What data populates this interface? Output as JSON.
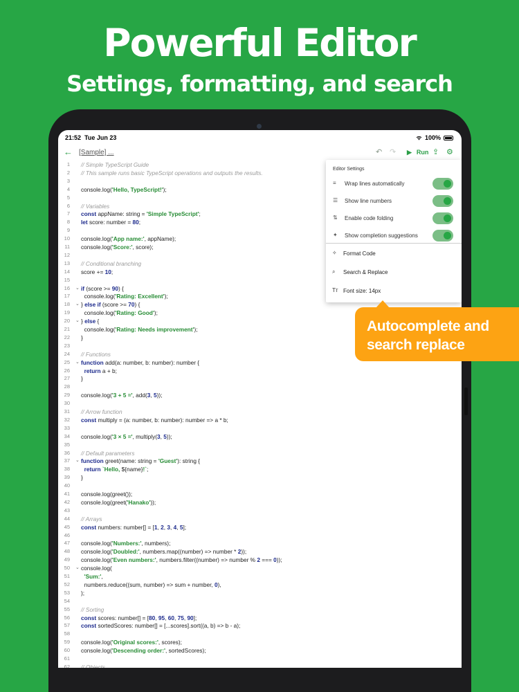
{
  "hero": {
    "title": "Powerful Editor",
    "subtitle": "Settings, formatting, and search"
  },
  "status": {
    "time": "21:52",
    "date": "Tue Jun 23",
    "battery": "100%"
  },
  "toolbar": {
    "file_title": "[Sample] ...",
    "run_label": "Run"
  },
  "menu": {
    "header": "Editor Settings",
    "toggles": [
      {
        "label": "Wrap lines automatically",
        "icon": "wrap-lines-icon",
        "on": true
      },
      {
        "label": "Show line numbers",
        "icon": "list-numbers-icon",
        "on": true
      },
      {
        "label": "Enable code folding",
        "icon": "fold-icon",
        "on": true
      },
      {
        "label": "Show completion suggestions",
        "icon": "magic-wand-icon",
        "on": true
      }
    ],
    "actions": [
      {
        "label": "Format Code",
        "icon": "sparkle-icon"
      },
      {
        "label": "Search & Replace",
        "icon": "search-replace-icon"
      },
      {
        "label": "Font size: 14px",
        "icon": "font-size-icon"
      }
    ]
  },
  "callout": {
    "line1": "Autocomplete and",
    "line2": "search replace"
  },
  "colors": {
    "background": "#27a645",
    "accent": "#2a9d46",
    "callout": "#fda313"
  },
  "code_lines": [
    {
      "n": "1",
      "fold": "",
      "html": "<span class=\"c\">// Simple TypeScript Guide</span>"
    },
    {
      "n": "2",
      "fold": "",
      "html": "<span class=\"c\">// This sample runs basic TypeScript operations and outputs the results.</span>"
    },
    {
      "n": "3",
      "fold": "",
      "html": ""
    },
    {
      "n": "4",
      "fold": "",
      "html": "console.log(<span class=\"s\">'Hello, TypeScript!'</span>);"
    },
    {
      "n": "5",
      "fold": "",
      "html": ""
    },
    {
      "n": "6",
      "fold": "",
      "html": "<span class=\"c\">// Variables</span>"
    },
    {
      "n": "7",
      "fold": "",
      "html": "<span class=\"k\">const</span> appName: string = <span class=\"s\">'Simple TypeScript'</span>;"
    },
    {
      "n": "8",
      "fold": "",
      "html": "<span class=\"k\">let</span> score: number = <span class=\"n\">80</span>;"
    },
    {
      "n": "9",
      "fold": "",
      "html": ""
    },
    {
      "n": "10",
      "fold": "",
      "html": "console.log(<span class=\"s\">'App name:'</span>, appName);"
    },
    {
      "n": "11",
      "fold": "",
      "html": "console.log(<span class=\"s\">'Score:'</span>, score);"
    },
    {
      "n": "12",
      "fold": "",
      "html": ""
    },
    {
      "n": "13",
      "fold": "",
      "html": "<span class=\"c\">// Conditional branching</span>"
    },
    {
      "n": "14",
      "fold": "",
      "html": "score += <span class=\"n\">10</span>;"
    },
    {
      "n": "15",
      "fold": "",
      "html": ""
    },
    {
      "n": "16",
      "fold": "⌄",
      "html": "<span class=\"k\">if</span> (score &gt;= <span class=\"n\">90</span>) {"
    },
    {
      "n": "17",
      "fold": "",
      "html": "  console.log(<span class=\"s\">'Rating: Excellent'</span>);"
    },
    {
      "n": "18",
      "fold": "⌄",
      "html": "} <span class=\"k\">else if</span> (score &gt;= <span class=\"n\">70</span>) {"
    },
    {
      "n": "19",
      "fold": "",
      "html": "  console.log(<span class=\"s\">'Rating: Good'</span>);"
    },
    {
      "n": "20",
      "fold": "⌄",
      "html": "} <span class=\"k\">else</span> {"
    },
    {
      "n": "21",
      "fold": "",
      "html": "  console.log(<span class=\"s\">'Rating: Needs improvement'</span>);"
    },
    {
      "n": "22",
      "fold": "",
      "html": "}"
    },
    {
      "n": "23",
      "fold": "",
      "html": ""
    },
    {
      "n": "24",
      "fold": "",
      "html": "<span class=\"c\">// Functions</span>"
    },
    {
      "n": "25",
      "fold": "⌄",
      "html": "<span class=\"k\">function</span> add(a: number, b: number): number {"
    },
    {
      "n": "26",
      "fold": "",
      "html": "  <span class=\"k\">return</span> a + b;"
    },
    {
      "n": "27",
      "fold": "",
      "html": "}"
    },
    {
      "n": "28",
      "fold": "",
      "html": ""
    },
    {
      "n": "29",
      "fold": "",
      "html": "console.log(<span class=\"s\">'3 + 5 ='</span>, add(<span class=\"n\">3</span>, <span class=\"n\">5</span>));"
    },
    {
      "n": "30",
      "fold": "",
      "html": ""
    },
    {
      "n": "31",
      "fold": "",
      "html": "<span class=\"c\">// Arrow function</span>"
    },
    {
      "n": "32",
      "fold": "",
      "html": "<span class=\"k\">const</span> multiply = (a: number, b: number): number =&gt; a * b;"
    },
    {
      "n": "33",
      "fold": "",
      "html": ""
    },
    {
      "n": "34",
      "fold": "",
      "html": "console.log(<span class=\"s\">'3 × 5 ='</span>, multiply(<span class=\"n\">3</span>, <span class=\"n\">5</span>));"
    },
    {
      "n": "35",
      "fold": "",
      "html": ""
    },
    {
      "n": "36",
      "fold": "",
      "html": "<span class=\"c\">// Default parameters</span>"
    },
    {
      "n": "37",
      "fold": "⌄",
      "html": "<span class=\"k\">function</span> greet(name: string = <span class=\"s\">'Guest'</span>): string {"
    },
    {
      "n": "38",
      "fold": "",
      "html": "  <span class=\"k\">return</span> <span class=\"s\">`Hello, </span>${name}<span class=\"s\">!`</span>;"
    },
    {
      "n": "39",
      "fold": "",
      "html": "}"
    },
    {
      "n": "40",
      "fold": "",
      "html": ""
    },
    {
      "n": "41",
      "fold": "",
      "html": "console.log(greet());"
    },
    {
      "n": "42",
      "fold": "",
      "html": "console.log(greet(<span class=\"s\">'Hanako'</span>));"
    },
    {
      "n": "43",
      "fold": "",
      "html": ""
    },
    {
      "n": "44",
      "fold": "",
      "html": "<span class=\"c\">// Arrays</span>"
    },
    {
      "n": "45",
      "fold": "",
      "html": "<span class=\"k\">const</span> numbers: number[] = [<span class=\"n\">1</span>, <span class=\"n\">2</span>, <span class=\"n\">3</span>, <span class=\"n\">4</span>, <span class=\"n\">5</span>];"
    },
    {
      "n": "46",
      "fold": "",
      "html": ""
    },
    {
      "n": "47",
      "fold": "",
      "html": "console.log(<span class=\"s\">'Numbers:'</span>, numbers);"
    },
    {
      "n": "48",
      "fold": "",
      "html": "console.log(<span class=\"s\">'Doubled:'</span>, numbers.map((number) =&gt; number * <span class=\"n\">2</span>));"
    },
    {
      "n": "49",
      "fold": "",
      "html": "console.log(<span class=\"s\">'Even numbers:'</span>, numbers.filter((number) =&gt; number % <span class=\"n\">2</span> === <span class=\"n\">0</span>));"
    },
    {
      "n": "50",
      "fold": "⌄",
      "html": "console.log("
    },
    {
      "n": "51",
      "fold": "",
      "html": "  <span class=\"s\">'Sum:'</span>,"
    },
    {
      "n": "52",
      "fold": "",
      "html": "  numbers.reduce((sum, number) =&gt; sum + number, <span class=\"n\">0</span>),"
    },
    {
      "n": "53",
      "fold": "",
      "html": ");"
    },
    {
      "n": "54",
      "fold": "",
      "html": ""
    },
    {
      "n": "55",
      "fold": "",
      "html": "<span class=\"c\">// Sorting</span>"
    },
    {
      "n": "56",
      "fold": "",
      "html": "<span class=\"k\">const</span> scores: number[] = [<span class=\"n\">80</span>, <span class=\"n\">95</span>, <span class=\"n\">60</span>, <span class=\"n\">75</span>, <span class=\"n\">90</span>];"
    },
    {
      "n": "57",
      "fold": "",
      "html": "<span class=\"k\">const</span> sortedScores: number[] = [...scores].sort((a, b) =&gt; b - a);"
    },
    {
      "n": "58",
      "fold": "",
      "html": ""
    },
    {
      "n": "59",
      "fold": "",
      "html": "console.log(<span class=\"s\">'Original scores:'</span>, scores);"
    },
    {
      "n": "60",
      "fold": "",
      "html": "console.log(<span class=\"s\">'Descending order:'</span>, sortedScores);"
    },
    {
      "n": "61",
      "fold": "",
      "html": ""
    },
    {
      "n": "62",
      "fold": "",
      "html": "<span class=\"c\">// Objects</span>"
    }
  ]
}
